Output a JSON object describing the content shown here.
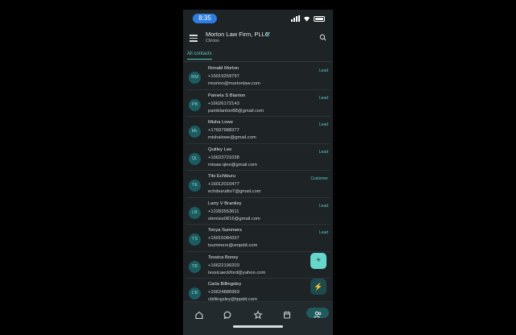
{
  "status": {
    "time": "8:35"
  },
  "header": {
    "firm": "Morton Law Firm, PLLC",
    "location": "Clinton"
  },
  "tabs": [
    {
      "label": "All contacts"
    }
  ],
  "contacts": [
    {
      "initials": "RM",
      "name": "Ronald Morton",
      "phone": "+16019259797",
      "email": "rmorton@mortonlaw.com",
      "tag": "Lead"
    },
    {
      "initials": "PB",
      "name": "Pamela S Blanton",
      "phone": "+16626172143",
      "email": "pamblanton88@gmail.com",
      "tag": "Lead"
    },
    {
      "initials": "ML",
      "name": "Misha Lowe",
      "phone": "+17697988377",
      "email": "mishalowe@gmail.com",
      "tag": "Lead"
    },
    {
      "initials": "QL",
      "name": "Quitley Lee",
      "phone": "+16623721038",
      "email": "misaw.qlee@gmail.com",
      "tag": "Lead"
    },
    {
      "initials": "TE",
      "name": "Tito Echiburu",
      "phone": "+16012010477",
      "email": "echiburutito7@gmail.com",
      "tag": "Customer"
    },
    {
      "initials": "LB",
      "name": "Larry V Brantley",
      "phone": "+12283553611",
      "email": "olemiss0816@gmail.com",
      "tag": "Lead"
    },
    {
      "initials": "TS",
      "name": "Tonya Summers",
      "phone": "+16015084337",
      "email": "tsummers@smpdd.com",
      "tag": "Lead"
    },
    {
      "initials": "TB",
      "name": "Tessica Boney",
      "phone": "+16622190203",
      "email": "tessicaeckford@yahoo.com",
      "tag": ""
    },
    {
      "initials": "CB",
      "name": "Carla Billingsley",
      "phone": "+16624886969",
      "email": "cbillingsley@tppdd.com",
      "tag": ""
    }
  ],
  "fabs": {
    "add": "+",
    "quick": "⚡"
  },
  "nav": [
    "home-icon",
    "chat-icon",
    "star-icon",
    "calendar-icon",
    "contacts-icon"
  ],
  "colors": {
    "accent": "#5cc9c0",
    "background": "#1e2326",
    "avatar": "#1b5c61"
  }
}
